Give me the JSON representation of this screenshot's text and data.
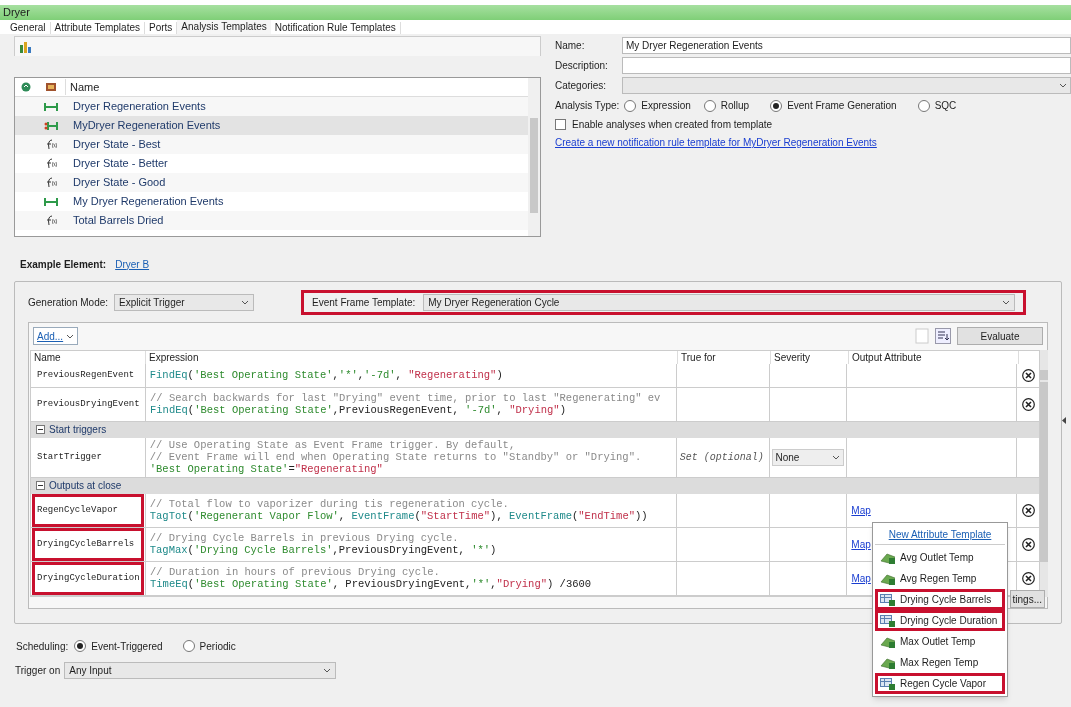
{
  "window": {
    "title": "Dryer"
  },
  "tabs": [
    {
      "label": "General",
      "selected": false
    },
    {
      "label": "Attribute Templates",
      "selected": false
    },
    {
      "label": "Ports",
      "selected": false
    },
    {
      "label": "Analysis Templates",
      "selected": true
    },
    {
      "label": "Notification Rule Templates",
      "selected": false
    }
  ],
  "analysis_list": {
    "column": "Name",
    "items": [
      {
        "kind": "event",
        "name": "Dryer Regeneration Events",
        "selected": false
      },
      {
        "kind": "event-new",
        "name": "MyDryer Regeneration Events",
        "selected": true
      },
      {
        "kind": "function",
        "name": "Dryer State - Best",
        "selected": false
      },
      {
        "kind": "function",
        "name": "Dryer State - Better",
        "selected": false
      },
      {
        "kind": "function",
        "name": "Dryer State - Good",
        "selected": false
      },
      {
        "kind": "event",
        "name": "My Dryer Regeneration Events",
        "selected": false
      },
      {
        "kind": "function",
        "name": "Total Barrels Dried",
        "selected": false
      }
    ]
  },
  "details": {
    "name_label": "Name:",
    "name_value": "My Dryer Regeneration Events",
    "description_label": "Description:",
    "categories_label": "Categories:",
    "analysis_type_label": "Analysis Type:",
    "analysis_types": [
      {
        "label": "Expression",
        "selected": false
      },
      {
        "label": "Rollup",
        "selected": false
      },
      {
        "label": "Event Frame Generation",
        "selected": true
      },
      {
        "label": "SQC",
        "selected": false
      }
    ],
    "enable_checkbox": {
      "label": "Enable analyses when created from template",
      "checked": false
    },
    "link": "Create a new notification rule template for MyDryer Regeneration Events"
  },
  "example_element": {
    "label": "Example Element:",
    "value": "Dryer B"
  },
  "generation_mode": {
    "label": "Generation Mode:",
    "value": "Explicit Trigger"
  },
  "event_frame_template": {
    "label": "Event Frame Template:",
    "value": "My Dryer Regeneration Cycle",
    "highlighted": true
  },
  "grid": {
    "add_button": "Add...",
    "evaluate_button": "Evaluate",
    "columns": [
      "Name",
      "Expression",
      "True for",
      "Severity",
      "Output Attribute"
    ],
    "rows": [
      {
        "kind": "variable",
        "name": "PreviousRegenEvent",
        "highlighted": false,
        "comments": [],
        "code": "FindEq('Best Operating State','*','-7d', \"Regenerating\")",
        "deletable": true
      },
      {
        "kind": "variable",
        "name": "PreviousDryingEvent",
        "highlighted": false,
        "comments": [
          "// Search backwards for last \"Drying\" event time, prior to last \"Regenerating\" ev"
        ],
        "code": "FindEq('Best Operating State',PreviousRegenEvent, '-7d', \"Drying\")",
        "deletable": true
      },
      {
        "kind": "group",
        "label": "Start triggers",
        "expanded": true
      },
      {
        "kind": "trigger",
        "name": "StartTrigger",
        "highlighted": false,
        "comments": [
          "// Use Operating State as Event Frame trigger. By default,",
          "// Event Frame will end when Operating State returns to \"Standby\" or \"Drying\"."
        ],
        "code": "'Best Operating State'=\"Regenerating\"",
        "true_for": "Set (optional)",
        "severity": "None",
        "deletable": false
      },
      {
        "kind": "group",
        "label": "Outputs at close",
        "expanded": true
      },
      {
        "kind": "output",
        "name": "RegenCycleVapor",
        "highlighted": true,
        "comments": [
          "// Total flow to vaporizer during tis regeneration cycle."
        ],
        "code": "TagTot('Regenerant Vapor Flow', EventFrame(\"StartTime\"), EventFrame(\"EndTime\"))",
        "map": "Map",
        "deletable": true
      },
      {
        "kind": "output",
        "name": "DryingCycleBarrels",
        "highlighted": true,
        "comments": [
          "// Drying Cycle Barrels in previous Drying cycle."
        ],
        "code": "TagMax('Drying Cycle Barrels',PreviousDryingEvent, '*')",
        "map": "Map",
        "deletable": true
      },
      {
        "kind": "output",
        "name": "DryingCycleDuration",
        "highlighted": true,
        "comments": [
          "// Duration in hours of previous Drying cycle."
        ],
        "code": "TimeEq('Best Operating State', PreviousDryingEvent,'*',\"Drying\") /3600",
        "map": "Map",
        "deletable": true
      }
    ],
    "settings_button": "tings..."
  },
  "attribute_menu": {
    "header": "New Attribute Template",
    "items": [
      {
        "kind": "computed",
        "label": "Avg Outlet Temp",
        "highlighted": false
      },
      {
        "kind": "computed",
        "label": "Avg Regen Temp",
        "highlighted": false
      },
      {
        "kind": "table",
        "label": "Drying Cycle Barrels",
        "highlighted": true
      },
      {
        "kind": "table",
        "label": "Drying Cycle Duration",
        "highlighted": true
      },
      {
        "kind": "computed",
        "label": "Max Outlet Temp",
        "highlighted": false
      },
      {
        "kind": "computed",
        "label": "Max Regen Temp",
        "highlighted": false
      },
      {
        "kind": "table",
        "label": "Regen Cycle Vapor",
        "highlighted": true
      }
    ]
  },
  "scheduling": {
    "label": "Scheduling:",
    "options": [
      {
        "label": "Event-Triggered",
        "selected": true
      },
      {
        "label": "Periodic",
        "selected": false
      }
    ]
  },
  "trigger_on": {
    "label": "Trigger on",
    "value": "Any Input"
  }
}
